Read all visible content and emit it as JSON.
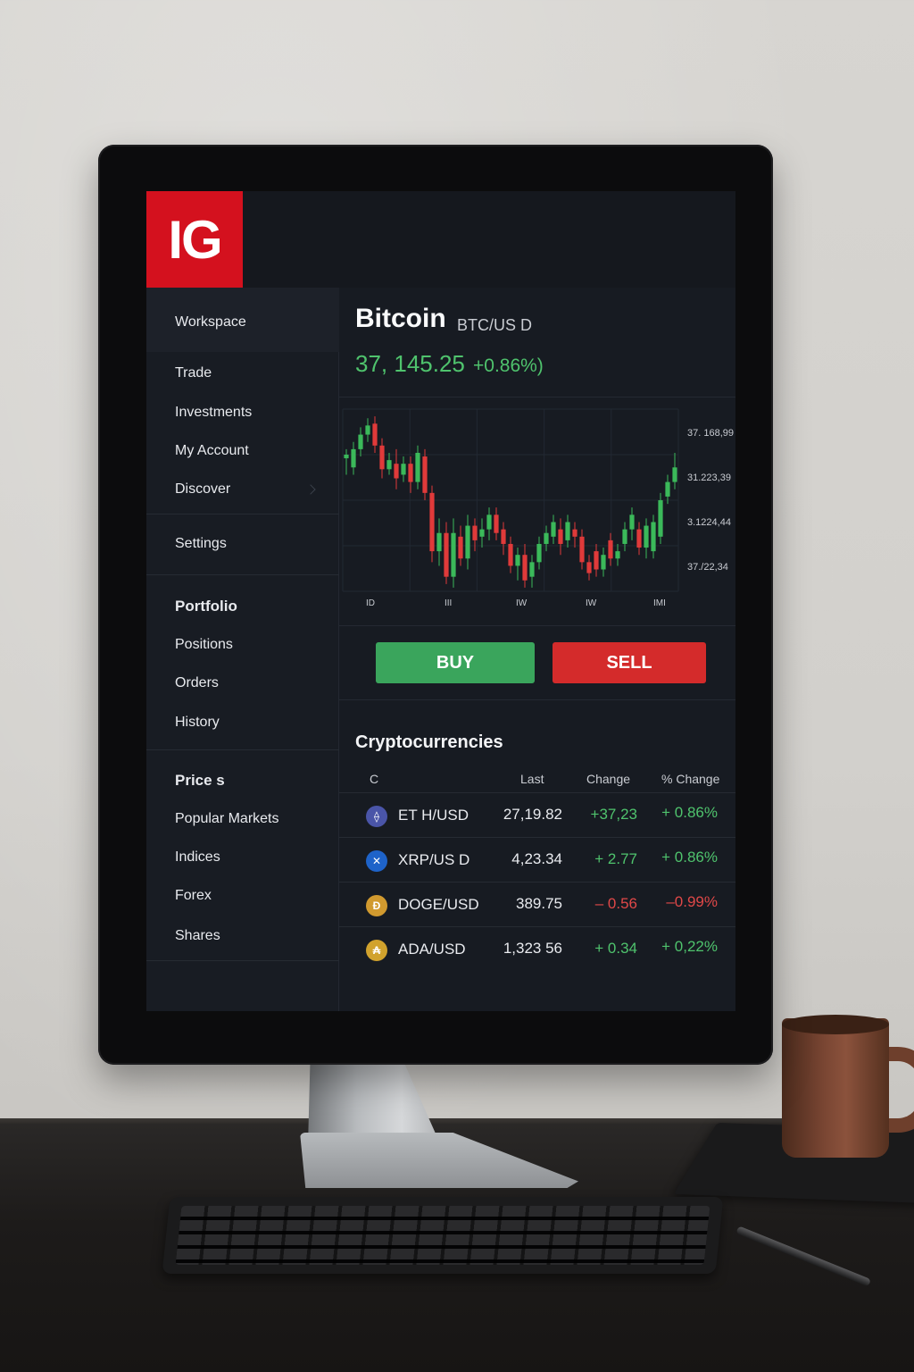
{
  "app": {
    "logo": "IG"
  },
  "sidebar": {
    "group1": [
      "Workspace",
      "Trade",
      "Investments",
      "My Account",
      "Discover"
    ],
    "group2": [
      "Settings"
    ],
    "group3_heading": "Portfolio",
    "group3": [
      "Positions",
      "Orders",
      "History"
    ],
    "group4_heading": "Price s",
    "group4": [
      "Popular Markets",
      "Indices",
      "Forex",
      "Shares"
    ]
  },
  "instrument": {
    "name": "Bitcoin",
    "pair": "BTC/US D",
    "price": "37, 145.25",
    "change": "+0.86%)"
  },
  "chart_data": {
    "type": "candlestick",
    "y_axis_labels": [
      "37. 168,99",
      "31.223,39",
      "3.1224,44",
      "37./22,34"
    ],
    "x_axis_labels": [
      "ID",
      "III",
      "IW",
      "IW",
      "IMI"
    ],
    "grid": true,
    "up_color": "#3bb95a",
    "down_color": "#e03a3a",
    "candles": [
      {
        "o": 27,
        "c": 25,
        "h": 22,
        "l": 36
      },
      {
        "o": 32,
        "c": 22,
        "h": 18,
        "l": 36
      },
      {
        "o": 22,
        "c": 14,
        "h": 10,
        "l": 26
      },
      {
        "o": 14,
        "c": 9,
        "h": 5,
        "l": 18
      },
      {
        "o": 8,
        "c": 20,
        "h": 4,
        "l": 24
      },
      {
        "o": 20,
        "c": 33,
        "h": 16,
        "l": 38
      },
      {
        "o": 33,
        "c": 28,
        "h": 24,
        "l": 36
      },
      {
        "o": 30,
        "c": 38,
        "h": 22,
        "l": 44
      },
      {
        "o": 36,
        "c": 30,
        "h": 26,
        "l": 40
      },
      {
        "o": 30,
        "c": 40,
        "h": 26,
        "l": 46
      },
      {
        "o": 40,
        "c": 24,
        "h": 20,
        "l": 44
      },
      {
        "o": 26,
        "c": 46,
        "h": 22,
        "l": 50
      },
      {
        "o": 46,
        "c": 78,
        "h": 42,
        "l": 84
      },
      {
        "o": 78,
        "c": 68,
        "h": 60,
        "l": 86
      },
      {
        "o": 68,
        "c": 92,
        "h": 62,
        "l": 96
      },
      {
        "o": 92,
        "c": 68,
        "h": 60,
        "l": 98
      },
      {
        "o": 70,
        "c": 82,
        "h": 64,
        "l": 86
      },
      {
        "o": 82,
        "c": 64,
        "h": 58,
        "l": 88
      },
      {
        "o": 64,
        "c": 72,
        "h": 60,
        "l": 78
      },
      {
        "o": 70,
        "c": 66,
        "h": 60,
        "l": 76
      },
      {
        "o": 66,
        "c": 58,
        "h": 54,
        "l": 72
      },
      {
        "o": 58,
        "c": 68,
        "h": 54,
        "l": 72
      },
      {
        "o": 66,
        "c": 74,
        "h": 62,
        "l": 80
      },
      {
        "o": 74,
        "c": 86,
        "h": 70,
        "l": 90
      },
      {
        "o": 86,
        "c": 80,
        "h": 76,
        "l": 94
      },
      {
        "o": 80,
        "c": 94,
        "h": 74,
        "l": 98
      },
      {
        "o": 92,
        "c": 84,
        "h": 80,
        "l": 98
      },
      {
        "o": 84,
        "c": 74,
        "h": 70,
        "l": 88
      },
      {
        "o": 74,
        "c": 68,
        "h": 64,
        "l": 78
      },
      {
        "o": 70,
        "c": 62,
        "h": 58,
        "l": 74
      },
      {
        "o": 66,
        "c": 74,
        "h": 60,
        "l": 80
      },
      {
        "o": 72,
        "c": 62,
        "h": 58,
        "l": 76
      },
      {
        "o": 66,
        "c": 70,
        "h": 62,
        "l": 76
      },
      {
        "o": 70,
        "c": 84,
        "h": 66,
        "l": 88
      },
      {
        "o": 84,
        "c": 90,
        "h": 80,
        "l": 94
      },
      {
        "o": 78,
        "c": 88,
        "h": 74,
        "l": 92
      },
      {
        "o": 88,
        "c": 80,
        "h": 76,
        "l": 92
      },
      {
        "o": 72,
        "c": 82,
        "h": 68,
        "l": 86
      },
      {
        "o": 82,
        "c": 78,
        "h": 74,
        "l": 86
      },
      {
        "o": 74,
        "c": 66,
        "h": 62,
        "l": 78
      },
      {
        "o": 66,
        "c": 58,
        "h": 54,
        "l": 72
      },
      {
        "o": 66,
        "c": 76,
        "h": 62,
        "l": 80
      },
      {
        "o": 76,
        "c": 64,
        "h": 60,
        "l": 82
      },
      {
        "o": 78,
        "c": 62,
        "h": 58,
        "l": 82
      },
      {
        "o": 70,
        "c": 50,
        "h": 46,
        "l": 74
      },
      {
        "o": 48,
        "c": 40,
        "h": 36,
        "l": 52
      },
      {
        "o": 40,
        "c": 32,
        "h": 24,
        "l": 44
      }
    ]
  },
  "actions": {
    "buy": "BUY",
    "sell": "SELL"
  },
  "table": {
    "title": "Cryptocurrencies",
    "headers": [
      "C",
      "Last",
      "Change",
      "% Change"
    ],
    "rows": [
      {
        "icon": "ethereum-icon",
        "icon_glyph": "⟠",
        "icon_color": "#4a55a8",
        "symbol": "ET H/USD",
        "last": "27,19.82",
        "change": "+37,23",
        "pct": "+ 0.86%",
        "dir": "up"
      },
      {
        "icon": "xrp-icon",
        "icon_glyph": "✕",
        "icon_color": "#1e63c9",
        "symbol": "XRP/US D",
        "last": "4,23.34",
        "change": "+ 2.77",
        "pct": "+ 0.86%",
        "dir": "up"
      },
      {
        "icon": "doge-icon",
        "icon_glyph": "Ð",
        "icon_color": "#d19a2f",
        "symbol": "DOGE/USD",
        "last": "389.75",
        "change": "– 0.56",
        "pct": "–0.99%",
        "dir": "down"
      },
      {
        "icon": "ada-icon",
        "icon_glyph": "₳",
        "icon_color": "#d1a22d",
        "symbol": "ADA/USD",
        "last": "1,323 56",
        "change": "+ 0.34",
        "pct": "+ 0,22%",
        "dir": "up"
      }
    ]
  }
}
